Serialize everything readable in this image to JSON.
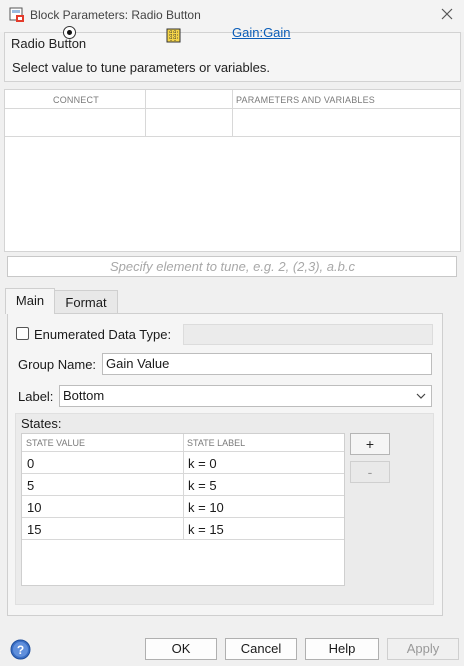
{
  "window": {
    "title": "Block Parameters: Radio Button",
    "icons": {
      "app": "block-params-icon",
      "close": "close-icon"
    }
  },
  "group": {
    "title": "Radio Button",
    "description": "Select value to tune parameters or variables."
  },
  "param_table": {
    "headers": {
      "connect": "CONNECT",
      "icon": "",
      "params": "PARAMETERS AND VARIABLES"
    },
    "rows": [
      {
        "connected": true,
        "icon": "gain-block-icon",
        "name": "Gain:Gain"
      }
    ]
  },
  "element_input": {
    "placeholder": "Specify element to tune, e.g. 2, (2,3), a.b.c"
  },
  "tabs": [
    {
      "label": "Main",
      "active": true
    },
    {
      "label": "Format",
      "active": false
    }
  ],
  "main": {
    "enum_label": "Enumerated Data Type:",
    "enum_checked": false,
    "group_name_label": "Group Name:",
    "group_name_value": "Gain Value",
    "label_label": "Label:",
    "label_value": "Bottom",
    "states_label": "States:",
    "states_headers": {
      "value": "STATE VALUE",
      "label": "STATE LABEL"
    },
    "states": [
      {
        "value": "0",
        "label": "k = 0"
      },
      {
        "value": "5",
        "label": "k = 5"
      },
      {
        "value": "10",
        "label": "k = 10"
      },
      {
        "value": "15",
        "label": "k = 15"
      }
    ],
    "add_label": "+",
    "remove_label": "-"
  },
  "footer": {
    "help_icon": "help-icon",
    "ok": "OK",
    "cancel": "Cancel",
    "help": "Help",
    "apply": "Apply"
  },
  "colors": {
    "link": "#0a5db8",
    "background": "#f0f0f0",
    "disabled_text": "#999999"
  }
}
